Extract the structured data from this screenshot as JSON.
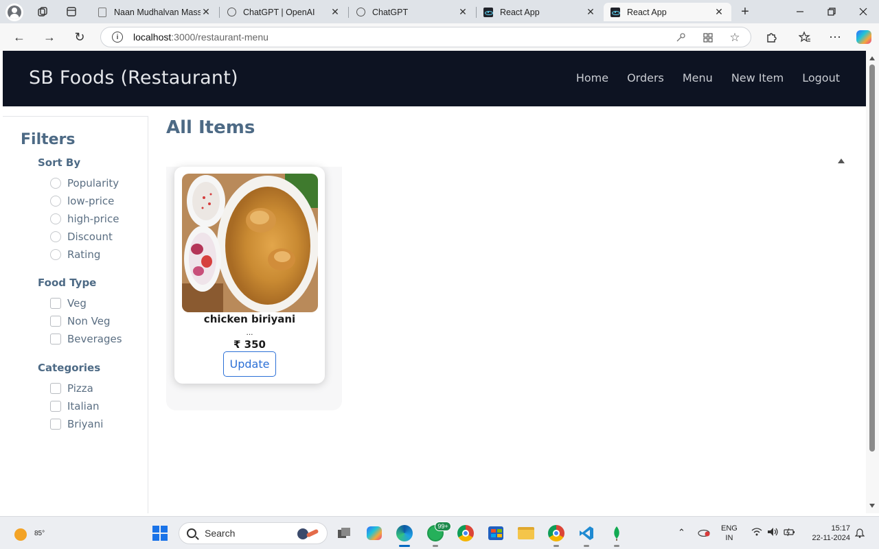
{
  "browser": {
    "tabs": [
      {
        "title": "Naan Mudhalvan Massi",
        "favicon": "document-icon",
        "active": false
      },
      {
        "title": "ChatGPT | OpenAI",
        "favicon": "openai-icon",
        "active": false
      },
      {
        "title": "ChatGPT",
        "favicon": "openai-icon",
        "active": false
      },
      {
        "title": "React App",
        "favicon": "react-icon",
        "active": false
      },
      {
        "title": "React App",
        "favicon": "react-icon",
        "active": true
      }
    ],
    "url_host": "localhost",
    "url_path": ":3000/restaurant-menu"
  },
  "app": {
    "brand": "SB Foods (Restaurant)",
    "nav": [
      "Home",
      "Orders",
      "Menu",
      "New Item",
      "Logout"
    ],
    "filters": {
      "title": "Filters",
      "sort_by": {
        "title": "Sort By",
        "options": [
          "Popularity",
          "low-price",
          "high-price",
          "Discount",
          "Rating"
        ]
      },
      "food_type": {
        "title": "Food Type",
        "options": [
          "Veg",
          "Non Veg",
          "Beverages"
        ]
      },
      "categories": {
        "title": "Categories",
        "options": [
          "Pizza",
          "Italian",
          "Briyani"
        ]
      }
    },
    "main": {
      "title": "All Items",
      "items": [
        {
          "name": "chicken biriyani",
          "description": "...",
          "price": "₹ 350",
          "button": "Update"
        }
      ]
    }
  },
  "taskbar": {
    "weather_temp": "85°",
    "search_placeholder": "Search",
    "whatsapp_badge": "99+",
    "lang_line1": "ENG",
    "lang_line2": "IN",
    "time": "15:17",
    "date": "22-11-2024"
  },
  "colors": {
    "header_bg": "#0d1322",
    "accent_text": "#4d6a85",
    "update_button": "#2a6fd6"
  }
}
